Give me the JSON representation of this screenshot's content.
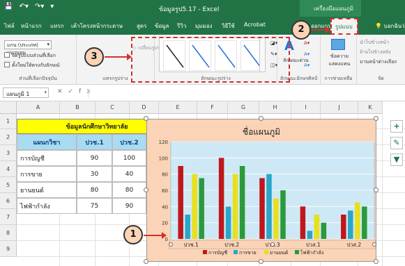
{
  "titlebar": {
    "title": "ข้อมูลรูป5.17  -  Excel",
    "context_header": "เครื่องมือแผนภูมิ"
  },
  "tabs": [
    {
      "label": "ไฟล์"
    },
    {
      "label": "หน้าแรก"
    },
    {
      "label": "แทรก"
    },
    {
      "label": "เค้าโครงหน้ากระดาษ"
    },
    {
      "label": "สูตร"
    },
    {
      "label": "ข้อมูล"
    },
    {
      "label": "รีวิว"
    },
    {
      "label": "มุมมอง"
    },
    {
      "label": "วิธีใช้"
    },
    {
      "label": "Acrobat"
    },
    {
      "label": "ออกแบบ"
    },
    {
      "label": "รูปแบบ"
    }
  ],
  "tell_me": "บอกฉันว่าค",
  "ribbon": {
    "current_selection": {
      "dropdown_value": "แกน (ประเภท) แนวนอน",
      "format_selection": "จัดรูปแบบส่วนที่เลือก",
      "reset_style": "ตั้งใหม่ให้ตรงกับลักษณ์",
      "label": "ส่วนที่เลือกปัจจุบัน"
    },
    "insert_shapes": {
      "change_shape": "เปลี่ยนรูปร่าง",
      "label": "แทรกรูปร่าง"
    },
    "shape_styles": {
      "label": "ลักษณะรูปร่าง"
    },
    "wordart": {
      "quick_styles": "ลักษณะด่วน",
      "label": "ลักษณะอักษรศิลป์"
    },
    "accessibility": {
      "alt_text": "ข้อความแสดงแทน",
      "label": "การช่วยเหลือ"
    },
    "arrange": {
      "bring_forward": "นำไปข้างหน้า",
      "send_backward": "ย้ายไปข้างหลัง",
      "selection_pane": "บานหน้าต่างเลือก",
      "label": "จัด"
    }
  },
  "formula_bar": {
    "name_box": "แผนภูมิ 1",
    "fx": "fx",
    "formula": ""
  },
  "columns": [
    "A",
    "B",
    "C",
    "D",
    "E",
    "F",
    "G",
    "H",
    "I",
    "J",
    "K"
  ],
  "rows": [
    "1",
    "2",
    "3",
    "4",
    "5",
    "6",
    "7",
    "8",
    "9"
  ],
  "table": {
    "title": "ข้อมูลนักศึกษาวิทยาลัย",
    "headers": [
      "แผนกวิชา",
      "ปวช.1",
      "ปวช.2"
    ],
    "rows": [
      [
        "การบัญชี",
        "90",
        "100"
      ],
      [
        "การขาย",
        "30",
        "40"
      ],
      [
        "ยานยนต์",
        "80",
        "80"
      ],
      [
        "ไฟฟ้ากำลัง",
        "75",
        "90"
      ]
    ]
  },
  "badges": {
    "b1": "1",
    "b2": "2",
    "b3": "3"
  },
  "colors": {
    "excel_green": "#217346",
    "chart_background": "#fbd3b6",
    "plot_background": "#cfe8f5",
    "header_cell": "#a9dbf2",
    "title_cell": "#ffff00",
    "highlight_red": "#d32f2f"
  },
  "chart_data": {
    "type": "bar",
    "title": "ชื่อแผนภูมิ",
    "categories": [
      "ปวช.1",
      "ปวช.2",
      "ปวช.3",
      "ปวส.1",
      "ปวส.2"
    ],
    "series": [
      {
        "name": "การบัญชี",
        "color": "#c0171d",
        "values": [
          90,
          100,
          75,
          40,
          30
        ]
      },
      {
        "name": "การขาย",
        "color": "#2aa6c9",
        "values": [
          30,
          40,
          80,
          10,
          35
        ]
      },
      {
        "name": "ยานยนต์",
        "color": "#e8e01a",
        "values": [
          80,
          80,
          50,
          30,
          45
        ]
      },
      {
        "name": "ไฟฟ้ากำลัง",
        "color": "#2a9a3a",
        "values": [
          75,
          90,
          60,
          20,
          40
        ]
      }
    ],
    "ylim": [
      0,
      120
    ],
    "yticks": [
      0,
      20,
      40,
      60,
      80,
      100,
      120
    ],
    "grid": true,
    "legend": "bottom"
  }
}
